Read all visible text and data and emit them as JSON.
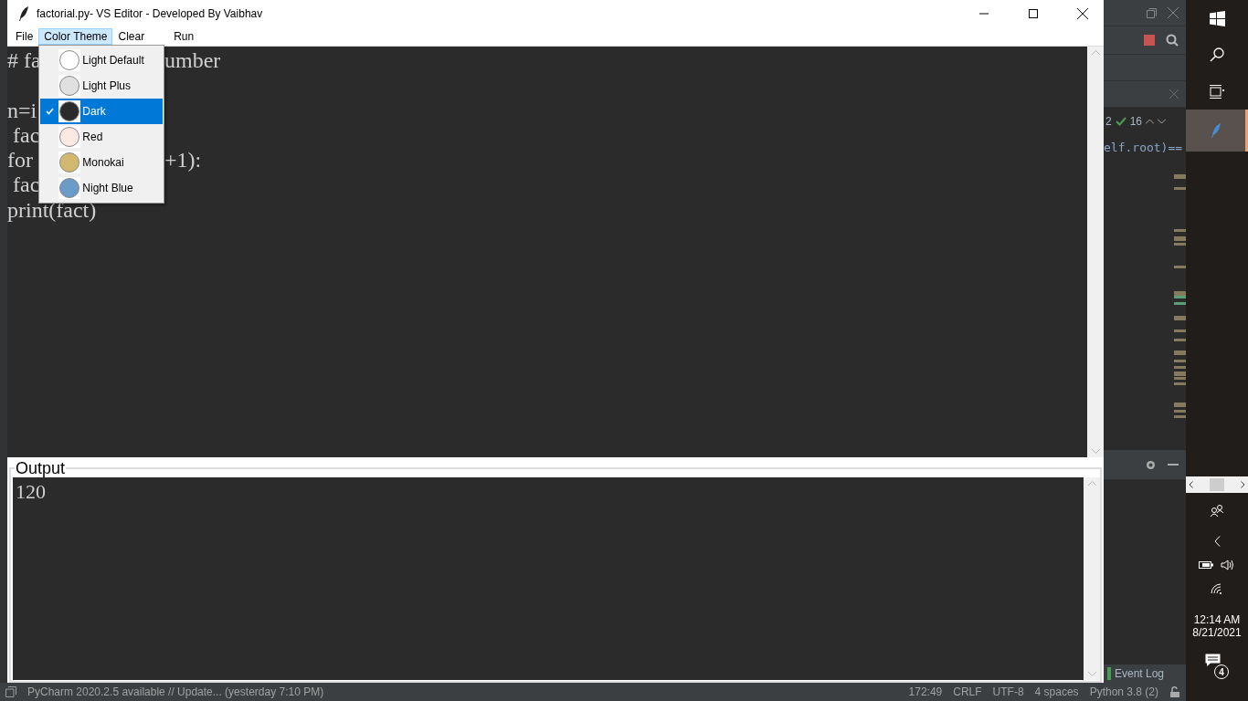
{
  "window": {
    "title": "factorial.py- VS Editor - Developed By Vaibhav"
  },
  "menu": [
    {
      "label": "File",
      "open": false
    },
    {
      "label": "Color Theme",
      "open": true
    },
    {
      "label": "Clear",
      "open": false
    },
    {
      "label": "Run",
      "open": false
    }
  ],
  "theme_menu": [
    {
      "label": "Light Default",
      "selected": false,
      "color": "#ffffff"
    },
    {
      "label": "Light Plus",
      "selected": false,
      "color": "#e0e0e0"
    },
    {
      "label": "Dark",
      "selected": true,
      "color": "#2b2b2b"
    },
    {
      "label": "Red",
      "selected": false,
      "color": "#fbe9e4"
    },
    {
      "label": "Monokai",
      "selected": false,
      "color": "#d3b86f"
    },
    {
      "label": "Night Blue",
      "selected": false,
      "color": "#6a9cc7"
    }
  ],
  "editor": {
    "lines": [
      {
        "kind": "code",
        "left": "# fa",
        "right": "umber"
      },
      {
        "kind": "blank"
      },
      {
        "kind": "code",
        "left": "n=i"
      },
      {
        "kind": "code",
        "left": " fac"
      },
      {
        "kind": "code",
        "left": "for",
        "right": "+1):"
      },
      {
        "kind": "code",
        "left": " fac"
      },
      {
        "kind": "code",
        "left": "print(fact)"
      }
    ]
  },
  "output": {
    "label": "Output",
    "text": "120"
  },
  "ide": {
    "hits": "2",
    "checks": "16",
    "code": "elf.root)==",
    "event_log": "Event Log"
  },
  "status_bar": {
    "message": "PyCharm 2020.2.5 available // Update... (yesterday 7:10 PM)",
    "items": [
      "172:49",
      "CRLF",
      "UTF-8",
      "4 spaces",
      "Python 3.8 (2)"
    ]
  },
  "taskbar": {
    "time": "12:14 AM",
    "date": "8/21/2021",
    "notifications": "4"
  }
}
